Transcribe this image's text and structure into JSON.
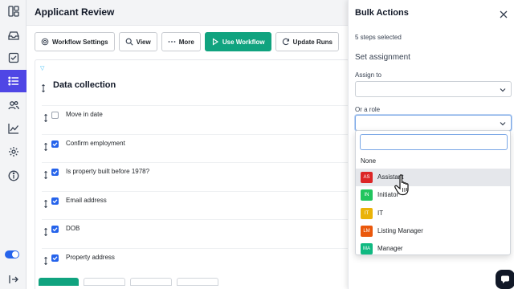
{
  "header": {
    "title": "Applicant Review"
  },
  "toolbar": {
    "workflow_settings": "Workflow Settings",
    "view": "View",
    "more": "More",
    "use_workflow": "Use Workflow",
    "update_runs": "Update Runs"
  },
  "section": {
    "title": "Data collection"
  },
  "rows": [
    {
      "label": "Move in date",
      "checked": false
    },
    {
      "label": "Confirm employment",
      "checked": true
    },
    {
      "label": "Is property built before 1978?",
      "checked": true
    },
    {
      "label": "Email address",
      "checked": true
    },
    {
      "label": "DOB",
      "checked": true
    },
    {
      "label": "Property address",
      "checked": true
    }
  ],
  "panel": {
    "title": "Bulk Actions",
    "steps_selected": "5 steps selected",
    "set_assignment": "Set assignment",
    "assign_to_label": "Assign to",
    "assign_to_value": "",
    "or_role_label": "Or a role",
    "or_role_value": "",
    "search_value": ""
  },
  "dropdown": {
    "none_label": "None",
    "options": [
      {
        "initials": "AS",
        "name": "Assistant",
        "color": "#dc2626",
        "hover": true
      },
      {
        "initials": "IN",
        "name": "Initiator",
        "color": "#22c55e",
        "hover": false
      },
      {
        "initials": "IT",
        "name": "IT",
        "color": "#eab308",
        "hover": false
      },
      {
        "initials": "LM",
        "name": "Listing Manager",
        "color": "#ea580c",
        "hover": false
      },
      {
        "initials": "MA",
        "name": "Manager",
        "color": "#10b981",
        "hover": false
      }
    ]
  },
  "colors": {
    "accent": "#4f46e5",
    "primary_button": "#10a37f",
    "checkbox": "#2563eb"
  }
}
